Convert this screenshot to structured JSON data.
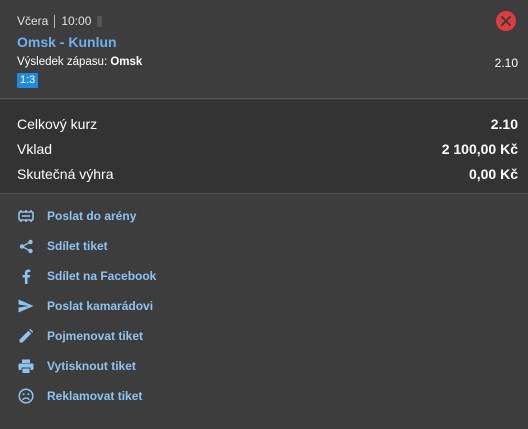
{
  "bet": {
    "day": "Včera",
    "time": "10:00",
    "match": "Omsk - Kunlun",
    "market_label": "Výsledek zápasu:",
    "pick": "Omsk",
    "odd": "2.10",
    "score": "1:3"
  },
  "summary": {
    "total_odds_label": "Celkový kurz",
    "total_odds_value": "2.10",
    "stake_label": "Vklad",
    "stake_value": "2 100,00 Kč",
    "win_label": "Skutečná výhra",
    "win_value": "0,00 Kč"
  },
  "actions": [
    {
      "label": "Poslat do arény",
      "icon": "arena-icon"
    },
    {
      "label": "Sdílet tiket",
      "icon": "share-icon"
    },
    {
      "label": "Sdílet na Facebook",
      "icon": "facebook-icon"
    },
    {
      "label": "Poslat kamarádovi",
      "icon": "send-icon"
    },
    {
      "label": "Pojmenovat tiket",
      "icon": "pencil-icon"
    },
    {
      "label": "Vytisknout tiket",
      "icon": "print-icon"
    },
    {
      "label": "Reklamovat tiket",
      "icon": "sad-face-icon"
    }
  ],
  "colors": {
    "background": "#3d3d3d",
    "summary_background": "#333333",
    "link": "#8ec3f2",
    "match_title": "#6fb0ee",
    "badge": "#1e8be0",
    "close": "#e23b3b"
  }
}
